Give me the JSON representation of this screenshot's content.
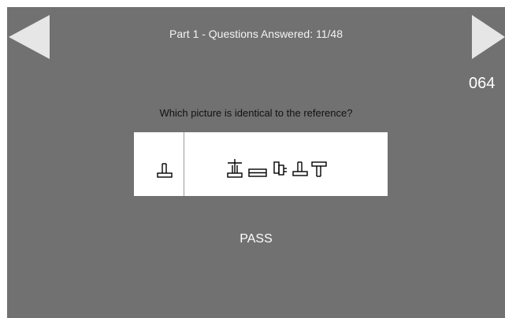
{
  "header": {
    "progress_text": "Part 1 - Questions Answered:  11/48",
    "code": "064"
  },
  "navigation": {
    "prev_icon": "left-arrow-icon",
    "next_icon": "right-arrow-icon"
  },
  "question": {
    "prompt": "Which picture is identical to the reference?",
    "reference_icon": "t-shape-glyph-icon",
    "choices": [
      {
        "icon": "t-shape-crossbar-glyph-icon"
      },
      {
        "icon": "flat-bar-glyph-icon"
      },
      {
        "icon": "rotated-glyph-icon"
      },
      {
        "icon": "t-shape-glyph-icon"
      },
      {
        "icon": "inverted-t-glyph-icon"
      }
    ]
  },
  "result": {
    "status": "PASS"
  },
  "colors": {
    "background": "#717171",
    "panel": "#ffffff",
    "arrow": "#e6e6e6"
  }
}
